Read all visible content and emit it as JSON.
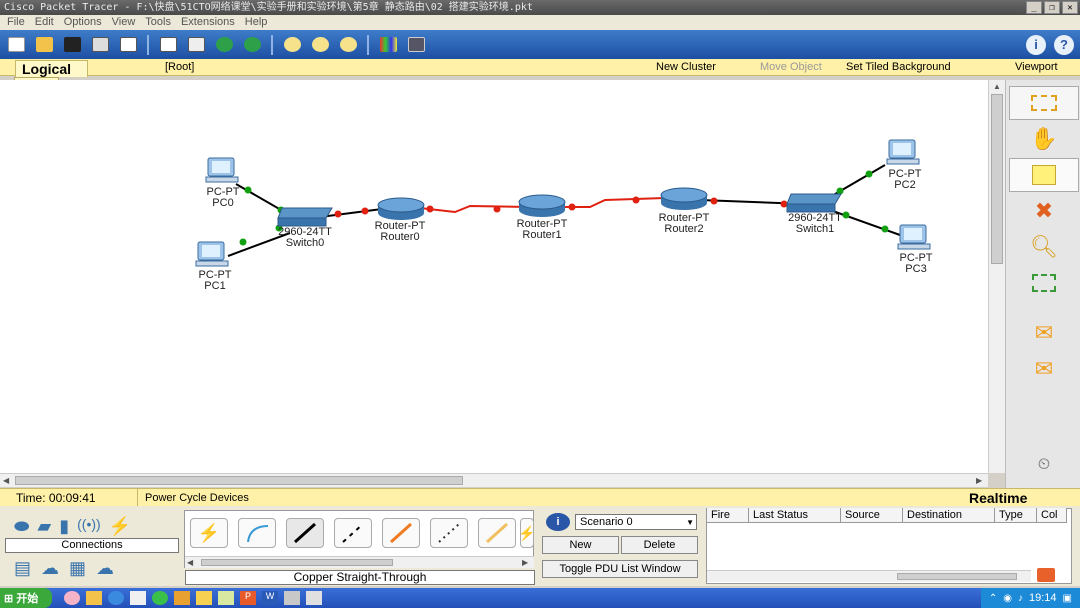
{
  "window": {
    "title": "Cisco Packet Tracer - F:\\快盘\\51CTO网络课堂\\实验手册和实验环境\\第5章 静态路由\\02 搭建实验环境.pkt",
    "minimize": "_",
    "restore": "❐",
    "close": "✕"
  },
  "menu": [
    "File",
    "Edit",
    "Options",
    "View",
    "Tools",
    "Extensions",
    "Help"
  ],
  "subbar": {
    "tab": "Logical",
    "root": "[Root]",
    "new_cluster": "New Cluster",
    "move_object": "Move Object",
    "set_tiled_background": "Set Tiled Background",
    "viewport": "Viewport"
  },
  "devices": {
    "pc0": {
      "type": "PC-PT",
      "name": "PC0"
    },
    "pc1": {
      "type": "PC-PT",
      "name": "PC1"
    },
    "pc2": {
      "type": "PC-PT",
      "name": "PC2"
    },
    "pc3": {
      "type": "PC-PT",
      "name": "PC3"
    },
    "switch0": {
      "type": "2960-24TT",
      "name": "Switch0"
    },
    "switch1": {
      "type": "2960-24TT",
      "name": "Switch1"
    },
    "router0": {
      "type": "Router-PT",
      "name": "Router0"
    },
    "router1": {
      "type": "Router-PT",
      "name": "Router1"
    },
    "router2": {
      "type": "Router-PT",
      "name": "Router2"
    }
  },
  "colors": {
    "link_up": "#10a010",
    "link_serial": "#e02010",
    "link_copper": "#000000",
    "toolbar": "#2a5cb0",
    "subbar": "#fff1a8"
  },
  "status": {
    "time": "Time: 00:09:41",
    "power_cycle": "Power Cycle Devices",
    "mode": "Realtime"
  },
  "device_panel": {
    "category": "Connections",
    "selected_cable": "Copper Straight-Through"
  },
  "scenario": {
    "info": "i",
    "selected": "Scenario 0",
    "new": "New",
    "delete": "Delete",
    "toggle": "Toggle PDU List Window"
  },
  "pdu_table": {
    "columns": [
      "Fire",
      "Last Status",
      "Source",
      "Destination",
      "Type",
      "Col"
    ]
  },
  "taskbar": {
    "start": "开始",
    "clock": "19:14"
  }
}
